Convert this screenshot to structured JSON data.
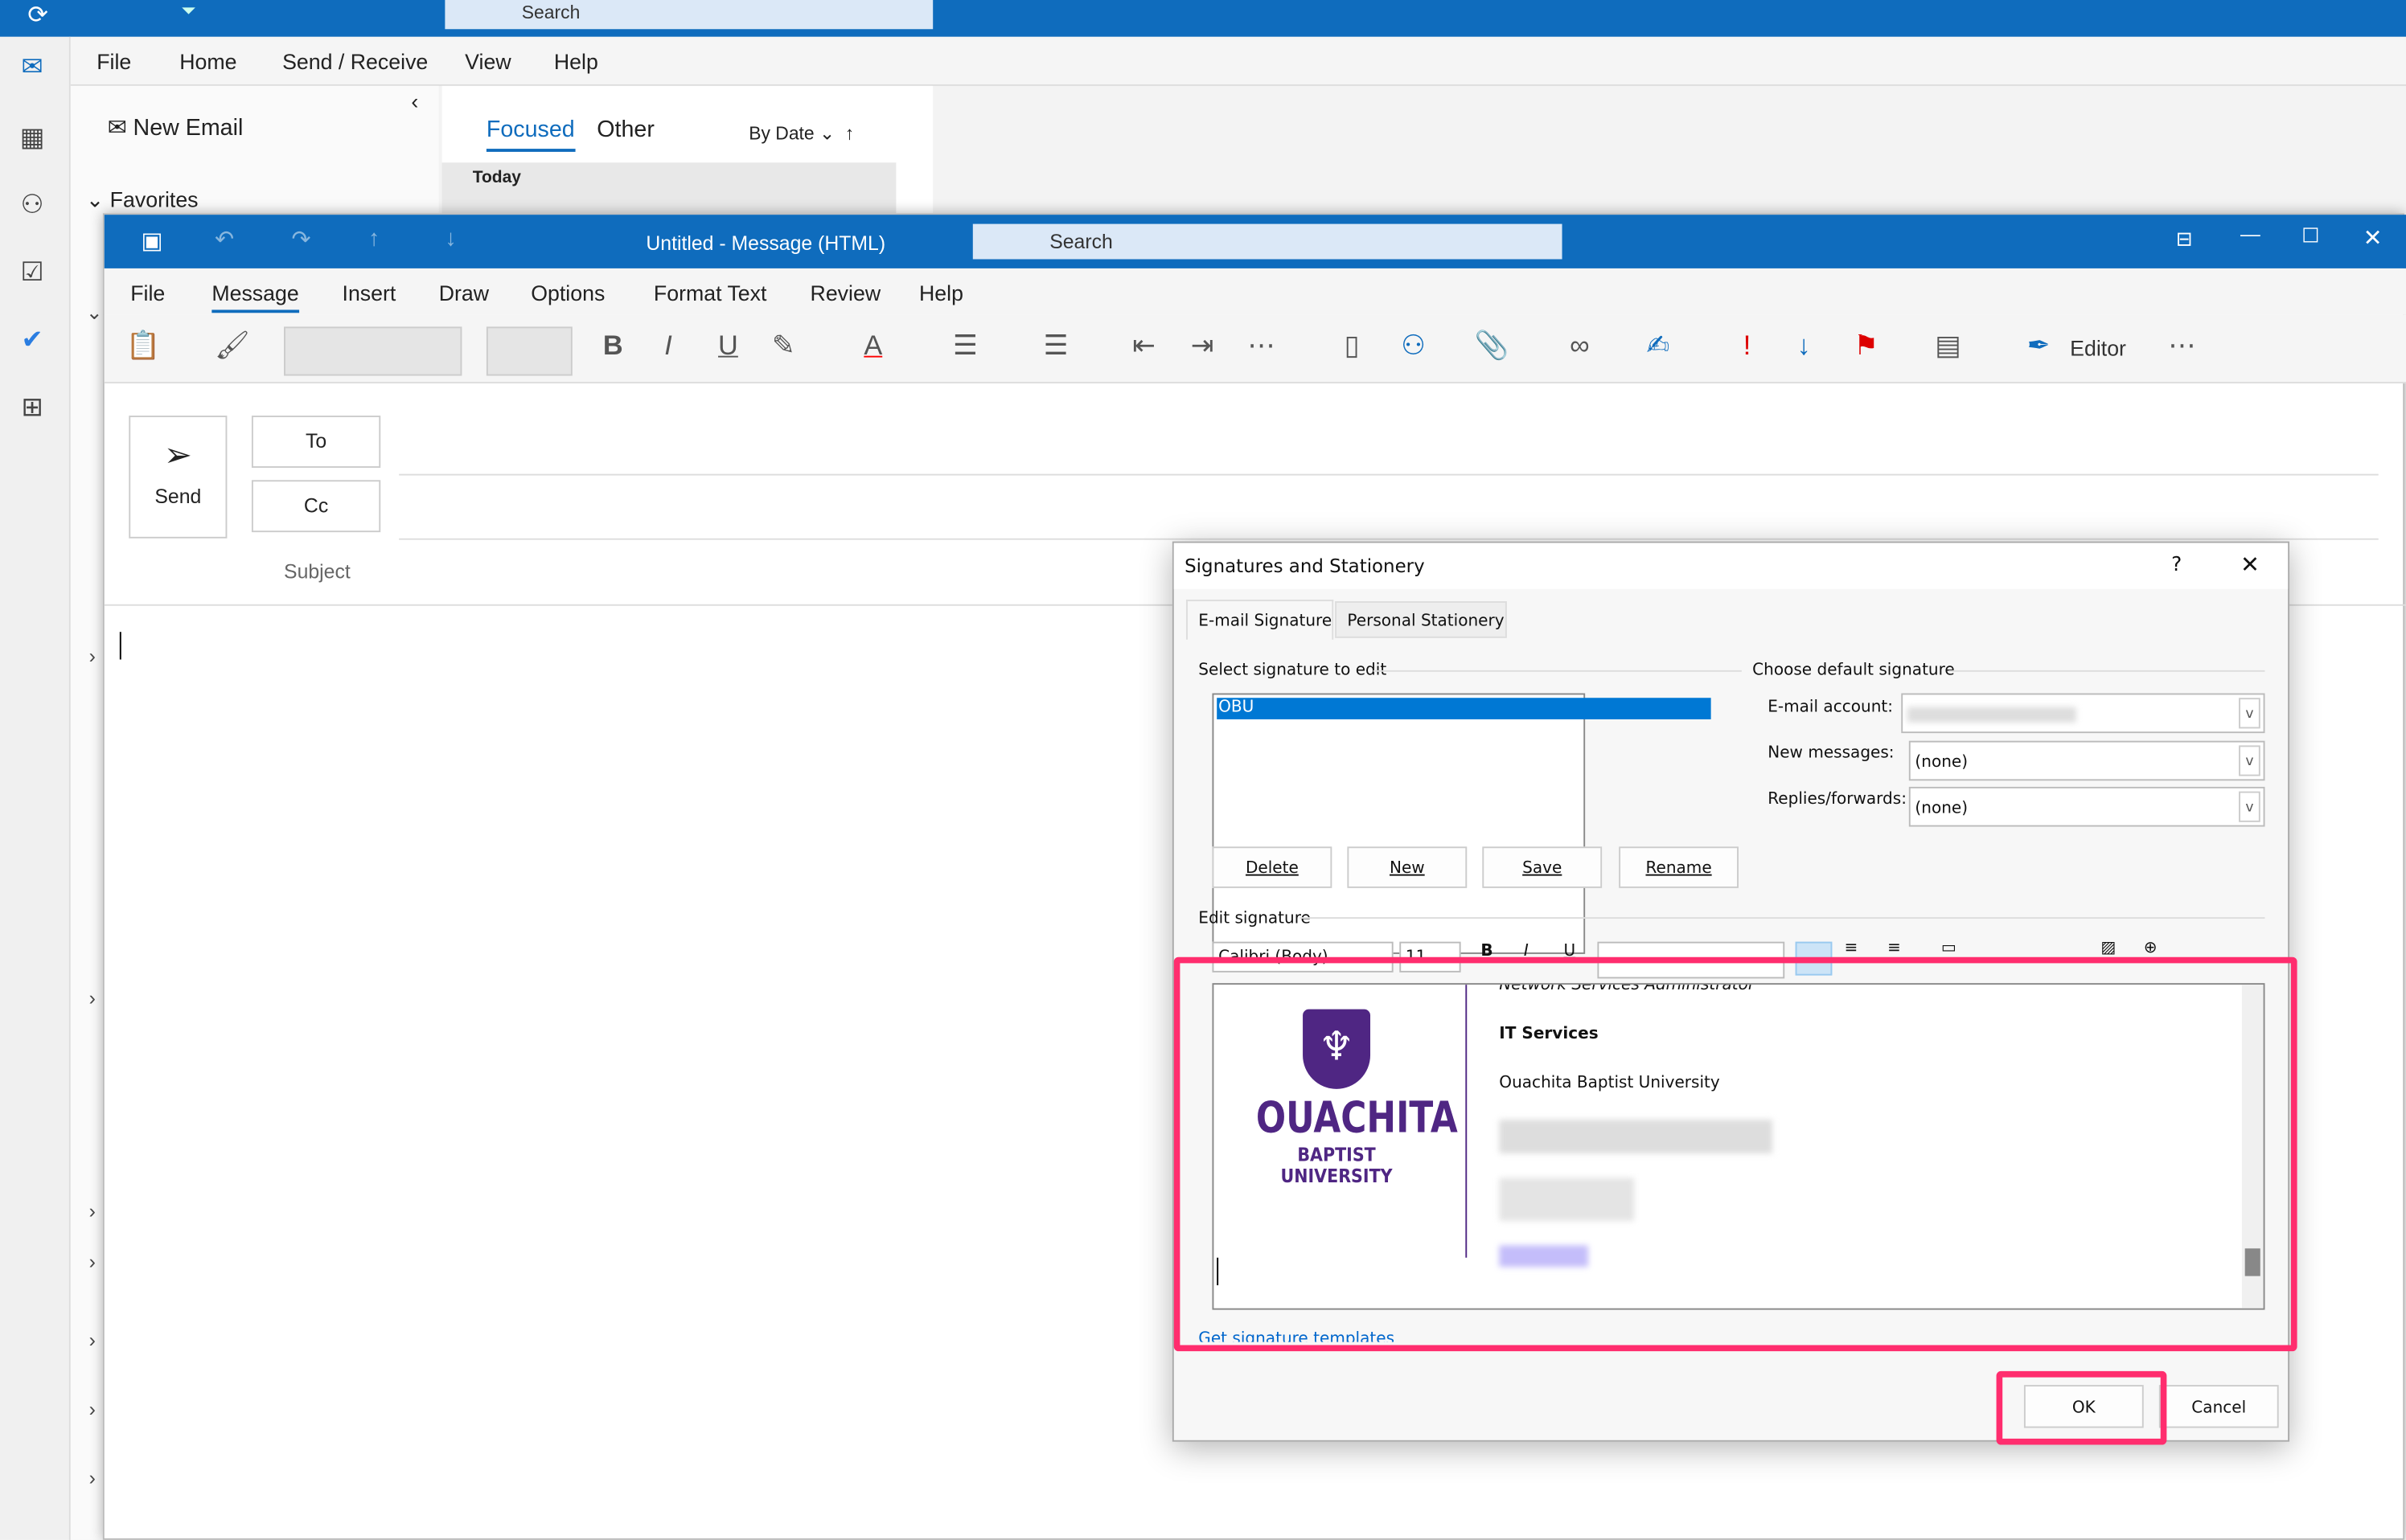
{
  "app": {
    "search_placeholder": "Search",
    "menu": [
      "File",
      "Home",
      "Send / Receive",
      "View",
      "Help"
    ],
    "new_email": "New Email",
    "favorites": "Favorites",
    "list_tabs": [
      "Focused",
      "Other"
    ],
    "sort": "By Date",
    "group": "Today"
  },
  "message": {
    "title": "Untitled  -  Message (HTML)",
    "search_placeholder": "Search",
    "tabs": [
      "File",
      "Message",
      "Insert",
      "Draw",
      "Options",
      "Format Text",
      "Review",
      "Help"
    ],
    "active_tab": "Message",
    "editor": "Editor",
    "send": "Send",
    "to": "To",
    "cc": "Cc",
    "subject": "Subject"
  },
  "dialog": {
    "title": "Signatures and Stationery",
    "help": "?",
    "tabs": [
      "E-mail Signature",
      "Personal Stationery"
    ],
    "select_label": "Select signature to edit",
    "signatures": [
      "OBU"
    ],
    "buttons": [
      "Delete",
      "New",
      "Save",
      "Rename"
    ],
    "default_label": "Choose default signature",
    "account_label": "E-mail account:",
    "new_messages_label": "New messages:",
    "new_messages_value": "(none)",
    "replies_label": "Replies/forwards:",
    "replies_value": "(none)",
    "edit_label": "Edit signature",
    "font": "Calibri (Body)",
    "size": "11",
    "sig_lines": {
      "title_partial": "Network Services Administrator",
      "dept": "IT Services",
      "org": "Ouachita Baptist University"
    },
    "logo": {
      "main": "OUACHITA",
      "sub": "BAPTIST UNIVERSITY"
    },
    "templates_link": "Get signature templates",
    "ok": "OK",
    "cancel": "Cancel"
  },
  "colors": {
    "brand": "#0f6cbd",
    "highlight": "#ff2d6e",
    "logo": "#4f2683"
  }
}
